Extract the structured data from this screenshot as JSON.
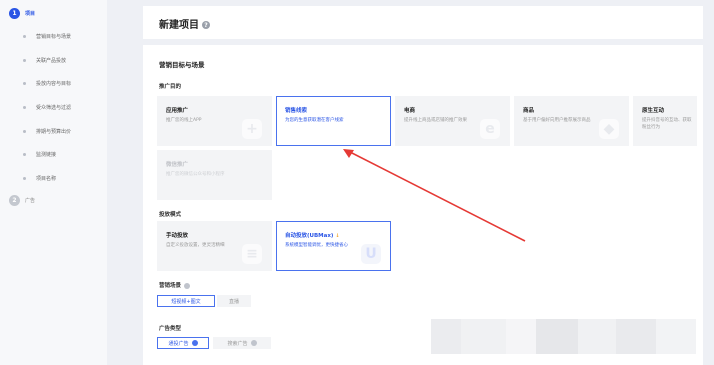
{
  "sidebar": {
    "steps": [
      {
        "num": "1",
        "label": "项目",
        "state": "active"
      },
      {
        "label": "营销目标与场景"
      },
      {
        "label": "关联产品投放"
      },
      {
        "label": "投放内容与目标"
      },
      {
        "label": "受众筛选与过滤"
      },
      {
        "label": "排期与预算出价"
      },
      {
        "label": "监测链接"
      },
      {
        "label": "项目名称"
      },
      {
        "num": "2",
        "label": "广告",
        "state": "pending"
      }
    ]
  },
  "header": {
    "title": "新建项目",
    "help_icon": "?"
  },
  "section": {
    "title": "营销目标与场景"
  },
  "promotion": {
    "label": "推广目的",
    "cards": [
      {
        "title": "应用推广",
        "desc": "推广您的线上APP",
        "icon": "+",
        "state": "normal"
      },
      {
        "title": "销售线索",
        "desc": "为您的生意获取潜在客户线索",
        "state": "selected"
      },
      {
        "title": "电商",
        "desc": "提升线上商品或店铺的推广效果",
        "icon": "e",
        "state": "normal"
      },
      {
        "title": "商品",
        "desc": "基于用户偏好向用户推荐展示商品",
        "icon": "◆",
        "state": "normal"
      },
      {
        "title": "原生互动",
        "desc": "提升抖音号的互动、获取粉丝行为",
        "icon": "♪",
        "state": "normal"
      },
      {
        "title": "微信推广",
        "desc": "推广您的微信公众号和小程序",
        "state": "disabled"
      }
    ]
  },
  "delivery": {
    "label": "投放模式",
    "cards": [
      {
        "title": "手动投放",
        "desc": "自定义投放设置，更灵活精细",
        "icon": "≡",
        "state": "normal"
      },
      {
        "title": "自动投放(UBMax)",
        "badge": "↓",
        "desc": "系统模型智能调优，更快捷省心",
        "icon": "U",
        "state": "selected"
      }
    ]
  },
  "scene": {
    "label": "营销场景",
    "options": [
      {
        "label": "短视频+图文",
        "state": "on"
      },
      {
        "label": "直播",
        "state": "off"
      }
    ]
  },
  "adtype": {
    "label": "广告类型",
    "options": [
      {
        "label": "通投广告",
        "state": "on"
      },
      {
        "label": "搜索广告",
        "state": "off"
      }
    ]
  },
  "colors": {
    "accent": "#2a55e5",
    "arrow": "#e53935",
    "page_bg": "#eef0f5"
  }
}
